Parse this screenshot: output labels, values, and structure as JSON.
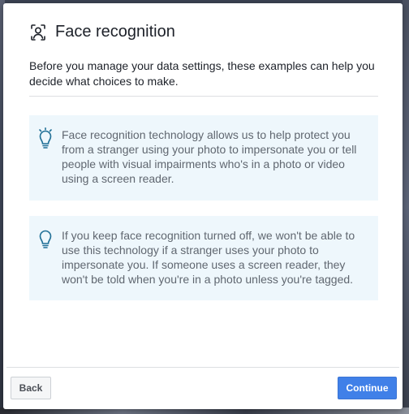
{
  "dialog": {
    "title": "Face recognition",
    "intro": "Before you manage your data settings, these examples can help you decide what choices to make."
  },
  "cards": [
    {
      "icon": "lightbulb-on-icon",
      "text": "Face recognition technology allows us to help protect you from a stranger using your photo to impersonate you or tell people with visual impairments who's in a photo or video using a screen reader."
    },
    {
      "icon": "lightbulb-off-icon",
      "text": "If you keep face recognition turned off, we won't be able to use this technology if a stranger uses your photo to impersonate you. If someone uses a screen reader, they won't be told when you're in a photo unless you're tagged."
    }
  ],
  "footer": {
    "back_label": "Back",
    "continue_label": "Continue"
  },
  "colors": {
    "primary_button": "#4080e8",
    "card_background": "#eef7fc",
    "lightbulb_icon": "#1f6f96",
    "body_text": "#606770",
    "title_text": "#1d2129"
  },
  "icons": {
    "header": "face-scan-icon"
  }
}
